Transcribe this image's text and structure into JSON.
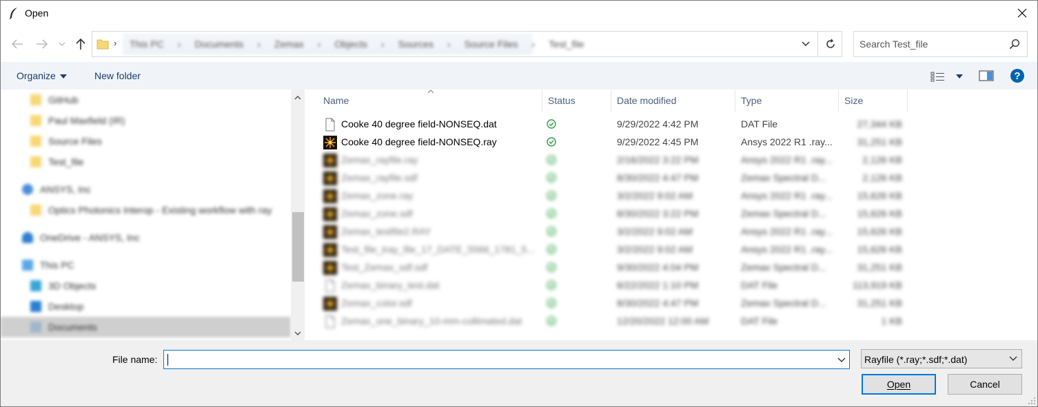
{
  "window": {
    "title": "Open"
  },
  "address": {
    "breadcrumbs": [
      "This PC",
      "Documents",
      "Zemax",
      "Objects",
      "Sources",
      "Source Files",
      "Test_file"
    ]
  },
  "search": {
    "placeholder": "Search Test_file"
  },
  "toolbar": {
    "organize_label": "Organize",
    "new_folder_label": "New folder"
  },
  "nav": {
    "items": [
      {
        "label": "GitHub",
        "icon": "folder-icon"
      },
      {
        "label": "Paul Maxfield (IR)",
        "icon": "folder-icon"
      },
      {
        "label": "Source Files",
        "icon": "folder-icon"
      },
      {
        "label": "Test_file",
        "icon": "folder-icon"
      },
      {
        "label": "ANSYS, Inc",
        "icon": "people-icon"
      },
      {
        "label": "Optics Photonics Interop - Existing workflow with ray",
        "icon": "folder-icon"
      },
      {
        "label": "OneDrive - ANSYS, Inc",
        "icon": "cloud-icon"
      },
      {
        "label": "This PC",
        "icon": "computer-icon"
      },
      {
        "label": "3D Objects",
        "icon": "cube-icon"
      },
      {
        "label": "Desktop",
        "icon": "desktop-icon"
      },
      {
        "label": "Documents",
        "icon": "document-icon",
        "selected": true
      }
    ]
  },
  "columns": {
    "name": "Name",
    "status": "Status",
    "date": "Date modified",
    "type": "Type",
    "size": "Size"
  },
  "files": [
    {
      "name": "Cooke 40 degree field-NONSEQ.dat",
      "date": "9/29/2022 4:42 PM",
      "type": "DAT File",
      "size": "27,344 KB",
      "icon": "file-icon"
    },
    {
      "name": "Cooke 40 degree field-NONSEQ.ray",
      "date": "9/29/2022 4:45 PM",
      "type": "Ansys 2022 R1 .ray...",
      "size": "31,251 KB",
      "icon": "ray-file-icon"
    },
    {
      "name": "Zemax_rayfile.ray",
      "date": "2/16/2022 3:22 PM",
      "type": "Ansys 2022 R1 .ray...",
      "size": "2,126 KB",
      "icon": "ray-file-icon"
    },
    {
      "name": "Zemax_rayfile.sdf",
      "date": "8/30/2022 4:47 PM",
      "type": "Zemax Spectral D...",
      "size": "2,126 KB",
      "icon": "ray-file-icon"
    },
    {
      "name": "Zemax_zone.ray",
      "date": "3/2/2022 9:02 AM",
      "type": "Ansys 2022 R1 .ray...",
      "size": "15,626 KB",
      "icon": "ray-file-icon"
    },
    {
      "name": "Zemax_zone.sdf",
      "date": "8/30/2022 3:22 PM",
      "type": "Zemax Spectral D...",
      "size": "15,626 KB",
      "icon": "ray-file-icon"
    },
    {
      "name": "Zemax_testfile2.RAY",
      "date": "3/2/2022 9:02 AM",
      "type": "Ansys 2022 R1 .ray...",
      "size": "15,626 KB",
      "icon": "ray-file-icon"
    },
    {
      "name": "Test_file_tray_file_17_DATE_5566_1781_5...",
      "date": "3/2/2022 9:02 AM",
      "type": "Ansys 2022 R1 .ray...",
      "size": "15,626 KB",
      "icon": "ray-file-icon"
    },
    {
      "name": "Test_Zemax_sdf.sdf",
      "date": "9/30/2022 4:04 PM",
      "type": "Zemax Spectral D...",
      "size": "31,251 KB",
      "icon": "ray-file-icon"
    },
    {
      "name": "Zemax_binary_test.dat",
      "date": "6/22/2022 1:10 PM",
      "type": "DAT File",
      "size": "113,919 KB",
      "icon": "file-icon"
    },
    {
      "name": "Zemax_color.sdf",
      "date": "8/30/2022 4:47 PM",
      "type": "Zemax Spectral D...",
      "size": "31,251 KB",
      "icon": "ray-file-icon"
    },
    {
      "name": "Zemax_one_binary_10-mm-collimated.dat",
      "date": "12/20/2022 12:00 AM",
      "type": "DAT File",
      "size": "1 KB",
      "icon": "file-icon"
    }
  ],
  "bottom": {
    "file_name_label": "File name:",
    "file_name_value": "",
    "filter_label": "Rayfile (*.ray;*.sdf;*.dat)",
    "open_label": "Open",
    "cancel_label": "Cancel"
  },
  "colors": {
    "accent": "#0078d7",
    "status_ok": "#2e9e43",
    "help": "#0063b1"
  }
}
